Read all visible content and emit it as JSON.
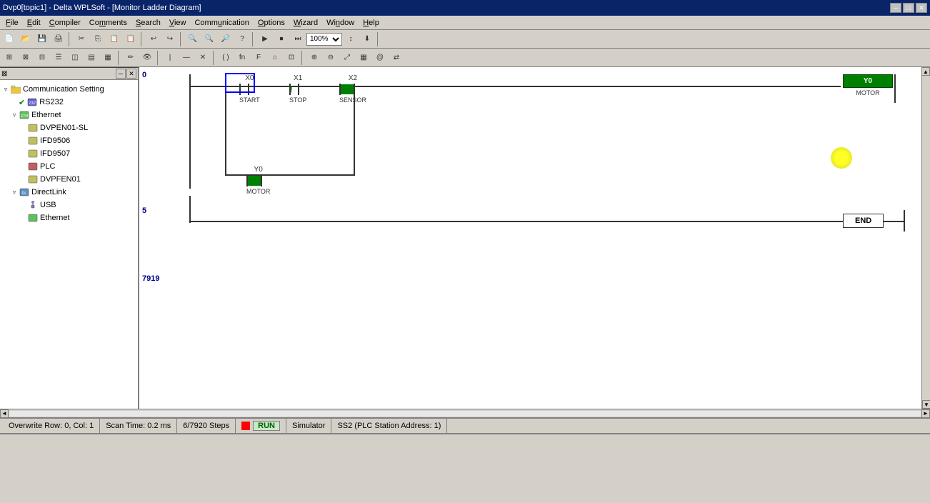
{
  "titleBar": {
    "title": "Dvp0[topic1] - Delta WPLSoft - [Monitor Ladder Diagram]",
    "controls": [
      "minimize",
      "maximize",
      "close"
    ]
  },
  "menuBar": {
    "items": [
      "File",
      "Edit",
      "Compiler",
      "Comments",
      "Search",
      "View",
      "Communication",
      "Options",
      "Wizard",
      "Window",
      "Help"
    ]
  },
  "sidebar": {
    "title": "Communication Setting",
    "nodes": [
      {
        "id": "comm-setting",
        "label": "Communication Setting",
        "expanded": true,
        "children": [
          {
            "id": "rs232",
            "label": "RS232",
            "checked": true,
            "children": []
          },
          {
            "id": "ethernet",
            "label": "Ethernet",
            "expanded": true,
            "children": [
              {
                "id": "dvpen01-sl",
                "label": "DVPEN01-SL",
                "children": []
              },
              {
                "id": "ifd9506",
                "label": "IFD9506",
                "children": []
              },
              {
                "id": "ifd9507",
                "label": "IFD9507",
                "children": []
              },
              {
                "id": "plc",
                "label": "PLC",
                "children": []
              },
              {
                "id": "dvpfen01",
                "label": "DVPFEN01",
                "children": []
              }
            ]
          },
          {
            "id": "directlink",
            "label": "DirectLink",
            "expanded": true,
            "children": [
              {
                "id": "usb",
                "label": "USB",
                "children": []
              },
              {
                "id": "ethernet2",
                "label": "Ethernet",
                "children": []
              }
            ]
          }
        ]
      }
    ]
  },
  "diagram": {
    "lineNumbers": [
      "0",
      "5",
      "7919"
    ],
    "rung1": {
      "contacts": [
        {
          "id": "X0",
          "label": "X0",
          "subLabel": "START",
          "type": "NO"
        },
        {
          "id": "X1",
          "label": "X1",
          "subLabel": "STOP",
          "type": "NC"
        },
        {
          "id": "X2",
          "label": "X2",
          "subLabel": "SENSOR",
          "type": "NO_GREEN"
        }
      ],
      "parallel": {
        "id": "Y0_p",
        "label": "Y0",
        "subLabel": "MOTOR",
        "type": "NO_GREEN"
      },
      "coil": {
        "id": "Y0",
        "label": "Y0",
        "subLabel": "MOTOR"
      }
    },
    "endBlock": {
      "label": "END"
    }
  },
  "statusBar": {
    "position": "Overwrite Row: 0, Col: 1",
    "scanTime": "Scan Time: 0.2 ms",
    "steps": "6/7920 Steps",
    "runState": "RUN",
    "simulator": "Simulator",
    "stationInfo": "SS2 (PLC Station Address: 1)"
  }
}
